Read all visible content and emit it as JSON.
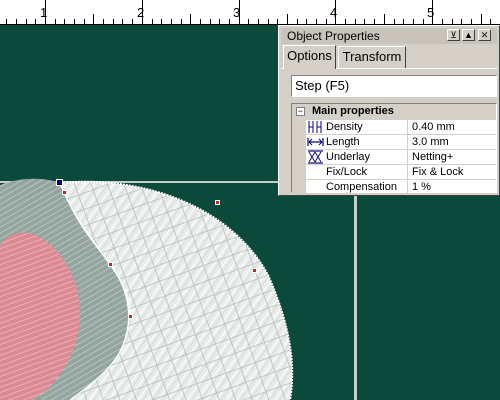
{
  "ruler": {
    "labels": [
      {
        "text": "1"
      },
      {
        "text": "2"
      },
      {
        "text": "3"
      },
      {
        "text": "4"
      },
      {
        "text": "5"
      }
    ]
  },
  "panel": {
    "title": "Object Properties",
    "buttons": {
      "pin": "⊻",
      "up": "▲",
      "close": "✕"
    },
    "tabs": [
      "Options",
      "Transform"
    ],
    "active_tab": "Options",
    "step_field": "Step (F5)",
    "group": {
      "collapse": "−",
      "label": "Main properties"
    },
    "properties": [
      {
        "name": "Density",
        "value": "0.40 mm",
        "icon": "density-icon"
      },
      {
        "name": "Length",
        "value": "3.0 mm",
        "icon": "length-icon"
      },
      {
        "name": "Underlay",
        "value": "Netting+",
        "icon": "underlay-icon"
      },
      {
        "name": "Fix/Lock",
        "value": "Fix & Lock",
        "icon": ""
      },
      {
        "name": "Compensation",
        "value": "1 %",
        "icon": ""
      }
    ]
  },
  "colors": {
    "canvas_bg": "#0b4a3a",
    "white_stitch": "#f2f2f2",
    "gray_stitch": "#9aaba4",
    "pink_stitch": "#e8a0a6",
    "handle_red": "#c0272d",
    "handle_blue": "#00008b"
  }
}
